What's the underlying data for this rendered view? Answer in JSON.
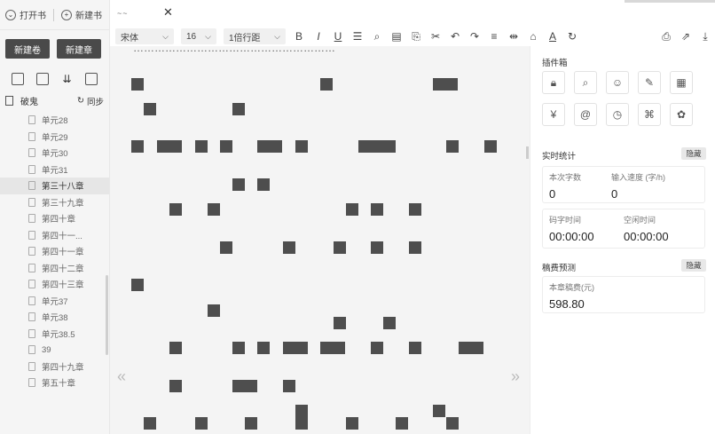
{
  "sidebar": {
    "open_book": "打开书",
    "new_book": "新建书",
    "new_volume": "新建卷",
    "new_chapter": "新建章",
    "tool_icons": [
      "add-file-icon",
      "insert-file-icon",
      "sort-icon",
      "trash-icon"
    ],
    "book_name": "破鬼",
    "sync_label": "同步",
    "chapters": [
      {
        "label": "单元28",
        "active": false
      },
      {
        "label": "单元29",
        "active": false
      },
      {
        "label": "单元30",
        "active": false
      },
      {
        "label": "单元31",
        "active": false
      },
      {
        "label": "第三十八章",
        "active": true
      },
      {
        "label": "第三十九章",
        "active": false
      },
      {
        "label": "第四十章",
        "active": false
      },
      {
        "label": "第四十一...",
        "active": false
      },
      {
        "label": "第四十一章",
        "active": false
      },
      {
        "label": "第四十二章",
        "active": false
      },
      {
        "label": "第四十三章",
        "active": false
      },
      {
        "label": "单元37",
        "active": false
      },
      {
        "label": "单元38",
        "active": false
      },
      {
        "label": "单元38.5",
        "active": false
      },
      {
        "label": "39",
        "active": false
      },
      {
        "label": "第四十九章",
        "active": false
      },
      {
        "label": "第五十章",
        "active": false
      }
    ]
  },
  "tab": {
    "title": "~~",
    "close": "✕"
  },
  "toolbar": {
    "font": "宋体",
    "size": "16",
    "line_spacing": "1倍行距",
    "icons": [
      "B",
      "I",
      "U",
      "☰",
      "⌕",
      "▤",
      "⎘",
      "✂",
      "↶",
      "↷",
      "≡",
      "⇹",
      "⌂",
      "A",
      "↻"
    ],
    "right_icons": [
      "save-icon",
      "export-icon",
      "download-icon"
    ]
  },
  "editor": {
    "top_text": "…………………………………………………",
    "prev": "«",
    "next": "»"
  },
  "plugins": {
    "title": "插件箱",
    "icons": [
      "lock-icon",
      "search-book-icon",
      "head-icon",
      "pencil-icon",
      "layout-icon",
      "yen-icon",
      "at-icon",
      "clock-icon",
      "tag-icon",
      "palette-icon"
    ]
  },
  "stats": {
    "title": "实时统计",
    "hide": "隐藏",
    "this_words_label": "本次字数",
    "this_words": "0",
    "speed_label": "输入速度 (字/h)",
    "speed": "0",
    "typing_time_label": "码字时间",
    "typing_time": "00:00:00",
    "idle_time_label": "空闲时间",
    "idle_time": "00:00:00"
  },
  "fee": {
    "title": "稿费预测",
    "hide": "隐藏",
    "label": "本章稿费(元)",
    "value": "598.80"
  }
}
